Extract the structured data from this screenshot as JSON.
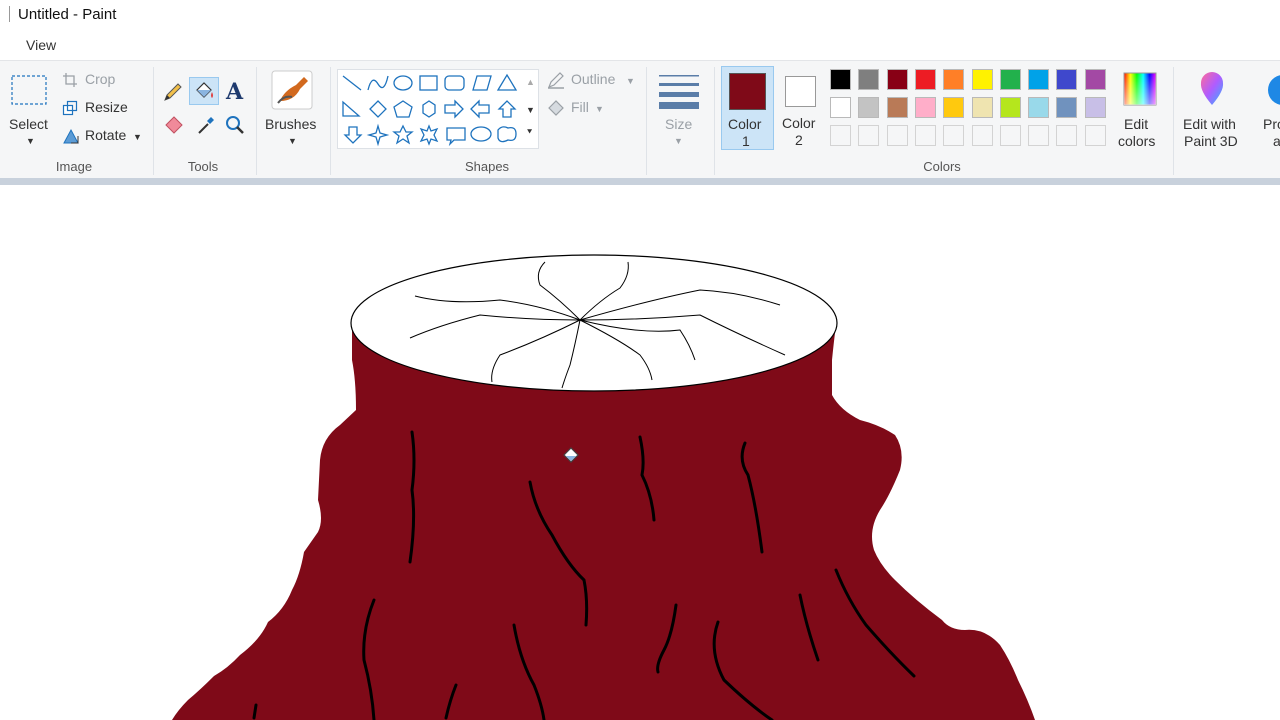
{
  "window": {
    "title": "Untitled - Paint"
  },
  "menu": {
    "view_tab": "View"
  },
  "image_group": {
    "label": "Image",
    "select_label": "Select",
    "crop_label": "Crop",
    "resize_label": "Resize",
    "rotate_label": "Rotate"
  },
  "tools_group": {
    "label": "Tools"
  },
  "brushes": {
    "label": "Brushes"
  },
  "shapes_group": {
    "label": "Shapes",
    "outline_label": "Outline",
    "fill_label": "Fill"
  },
  "size": {
    "label": "Size"
  },
  "colors_group": {
    "label": "Colors",
    "color1_label": "Color",
    "color1_num": "1",
    "color2_label": "Color",
    "color2_num": "2",
    "color1_value": "#7f0a18",
    "color2_value": "#ffffff",
    "edit_colors_line1": "Edit",
    "edit_colors_line2": "colors",
    "palette_row1": [
      "#000000",
      "#7f7f7f",
      "#880015",
      "#ed1c24",
      "#ff7f27",
      "#fff200",
      "#22b14c",
      "#00a2e8",
      "#3f48cc",
      "#a349a4"
    ],
    "palette_row2": [
      "#ffffff",
      "#c3c3c3",
      "#b97a57",
      "#ffaec9",
      "#ffc90e",
      "#efe4b0",
      "#b5e61d",
      "#99d9ea",
      "#7092be",
      "#c8bfe7"
    ]
  },
  "paint3d": {
    "line1": "Edit with",
    "line2": "Paint 3D"
  },
  "product": {
    "line1": "Pro",
    "line2": "a"
  },
  "drawing": {
    "fill_color": "#7f0a18",
    "outline_color": "#000000"
  }
}
